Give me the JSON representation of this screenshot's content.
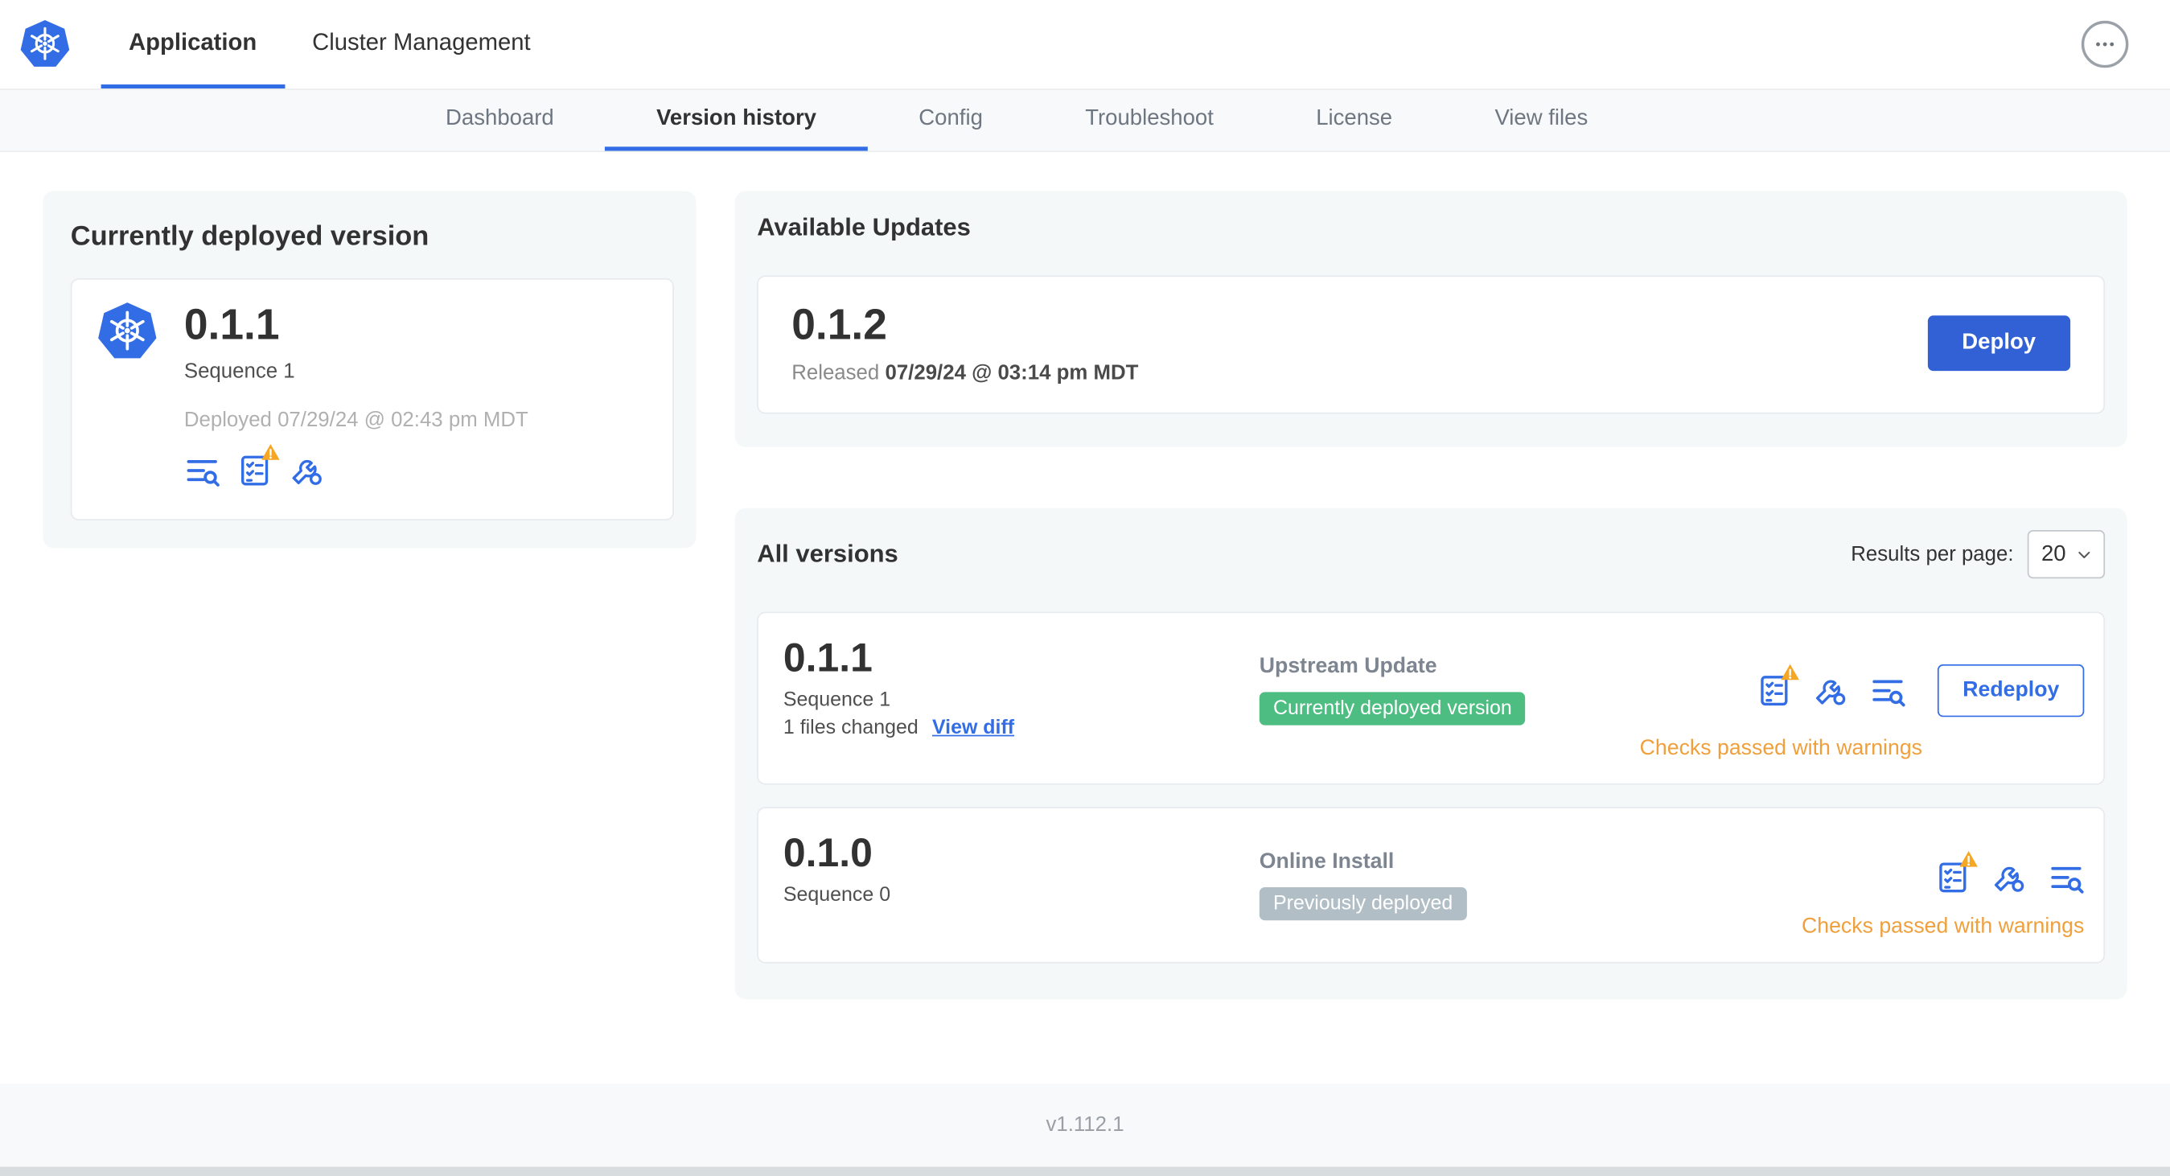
{
  "colors": {
    "accent": "#326DE6",
    "button_blue": "#3261d6",
    "badge_green": "#4EBD82",
    "badge_gray": "#B2BEC5",
    "warning_text": "#EFA03C",
    "warning_triangle": "#F5A623"
  },
  "icons": {
    "logo": "kubernetes-logo",
    "more": "ellipsis",
    "logs": "logs-lines-magnifier",
    "preflight": "checklist",
    "preflight_warning": "warning-triangle",
    "config": "wrench-gear",
    "select_chevron": "chevron-down"
  },
  "header": {
    "tabs": [
      {
        "label": "Application",
        "active": true
      },
      {
        "label": "Cluster Management",
        "active": false
      }
    ]
  },
  "subnav": {
    "items": [
      {
        "label": "Dashboard",
        "active": false
      },
      {
        "label": "Version history",
        "active": true
      },
      {
        "label": "Config",
        "active": false
      },
      {
        "label": "Troubleshoot",
        "active": false
      },
      {
        "label": "License",
        "active": false
      },
      {
        "label": "View files",
        "active": false
      }
    ]
  },
  "current_version": {
    "title": "Currently deployed version",
    "version": "0.1.1",
    "sequence": "Sequence 1",
    "deployed": "Deployed 07/29/24 @ 02:43 pm MDT"
  },
  "available_updates": {
    "title": "Available Updates",
    "version": "0.1.2",
    "released_prefix": "Released",
    "released_date": "07/29/24 @ 03:14 pm MDT",
    "deploy_label": "Deploy"
  },
  "all_versions": {
    "title": "All versions",
    "results_per_page_label": "Results per page:",
    "results_per_page_value": "20",
    "rows": [
      {
        "version": "0.1.1",
        "sequence": "Sequence 1",
        "files_changed": "1 files changed",
        "view_diff": "View diff",
        "source": "Upstream Update",
        "badge": "Currently deployed version",
        "badge_type": "green",
        "status": "Checks passed with warnings",
        "action_label": "Redeploy"
      },
      {
        "version": "0.1.0",
        "sequence": "Sequence 0",
        "source": "Online Install",
        "badge": "Previously deployed",
        "badge_type": "gray",
        "status": "Checks passed with warnings"
      }
    ]
  },
  "footer": {
    "version": "v1.112.1"
  }
}
